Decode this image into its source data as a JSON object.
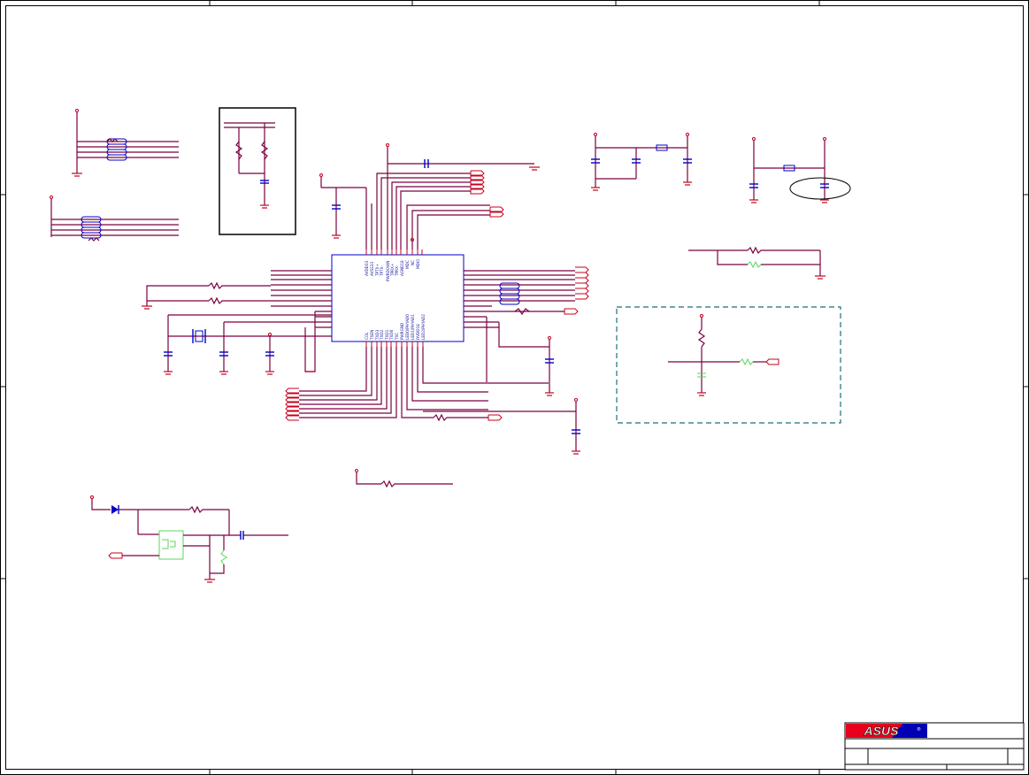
{
  "colors": {
    "wire": "#7a0040",
    "pin": "#c8001e",
    "component": "#0000c8",
    "highlight": "#5cd65c",
    "logo_red": "#e8001c",
    "logo_blue": "#0000b4"
  },
  "ic_top_pins": [
    "AVDD33",
    "AVSS33",
    "TPTX+",
    "TPTX-",
    "PWRDOWN",
    "TPRX+",
    "TPRX-",
    "AGND18",
    "MDC",
    "NC",
    "MDIO"
  ],
  "ic_bottom_pins": [
    "COL",
    "TXEN",
    "TXD3",
    "TXD2",
    "TXD1",
    "TXD0",
    "TXC",
    "PWRGND",
    "LED0/PHYAD0",
    "LED1/PHYAD1",
    "DVDD18",
    "LED2/PHYAD2"
  ],
  "title_block": {
    "logo": "ASUS",
    "logo_mark": "®"
  }
}
